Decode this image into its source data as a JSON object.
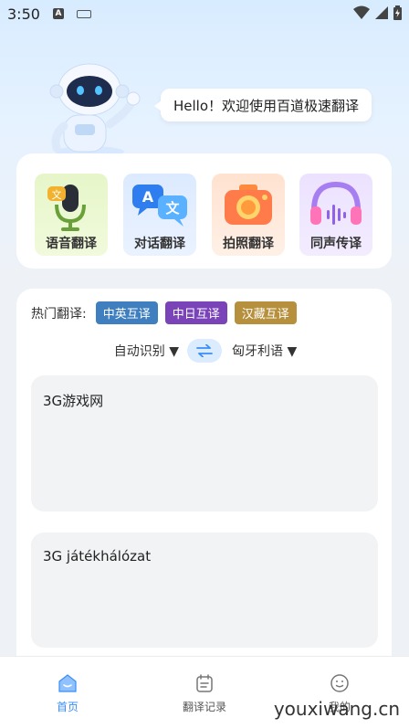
{
  "status_bar": {
    "time": "3:50",
    "notif_icon_letter": "A"
  },
  "greeting": {
    "text": "Hello！欢迎使用百道极速翻译"
  },
  "features": [
    {
      "label": "语音翻译",
      "icon": "microphone-icon",
      "badge": "文"
    },
    {
      "label": "对话翻译",
      "icon": "chat-translate-icon",
      "bubble_a": "A",
      "bubble_b": "文"
    },
    {
      "label": "拍照翻译",
      "icon": "camera-icon"
    },
    {
      "label": "同声传译",
      "icon": "headphones-icon"
    }
  ],
  "hot": {
    "label": "热门翻译:",
    "chips": [
      {
        "text": "中英互译",
        "color": "#3f7fbf"
      },
      {
        "text": "中日互译",
        "color": "#7a44b8"
      },
      {
        "text": "汉藏互译",
        "color": "#b7903d"
      }
    ]
  },
  "languages": {
    "source": "自动识别",
    "target": "匈牙利语",
    "arrow": "▼"
  },
  "input_text": "3G游戏网",
  "output_text": "3G játékhálózat",
  "tabs": [
    {
      "label": "首页",
      "icon": "home-icon",
      "active": true
    },
    {
      "label": "翻译记录",
      "icon": "history-icon",
      "active": false
    },
    {
      "label": "我的",
      "icon": "profile-icon",
      "active": false
    }
  ],
  "watermark": "youxiwang.cn",
  "colors": {
    "accent": "#3a8ef6",
    "swap_bg": "#dcecff"
  }
}
